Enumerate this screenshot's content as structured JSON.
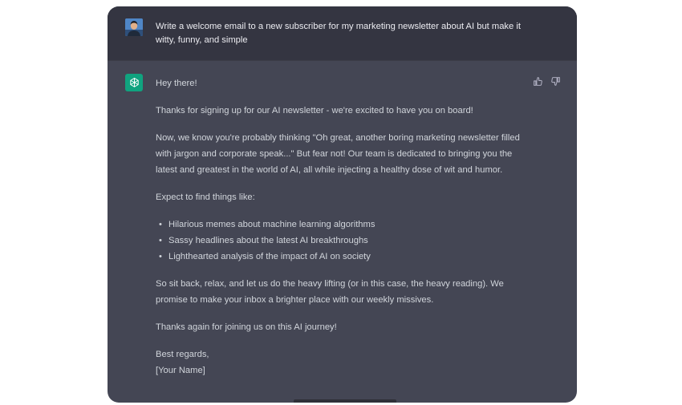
{
  "user_message": {
    "avatar_icon": "user-avatar-photo",
    "text": "Write a welcome email to a new subscriber for my marketing newsletter about AI but make it witty, funny, and simple"
  },
  "assistant_message": {
    "avatar_icon": "chatgpt-logo-icon",
    "avatar_color": "#10a37f",
    "greeting": "Hey there!",
    "p1": "Thanks for signing up for our AI newsletter - we're excited to have you on board!",
    "p2": "Now, we know you're probably thinking \"Oh great, another boring marketing newsletter filled with jargon and corporate speak...\" But fear not! Our team is dedicated to bringing you the latest and greatest in the world of AI, all while injecting a healthy dose of wit and humor.",
    "p3": "Expect to find things like:",
    "bullets": [
      "Hilarious memes about machine learning algorithms",
      "Sassy headlines about the latest AI breakthroughs",
      "Lighthearted analysis of the impact of AI on society"
    ],
    "p4": "So sit back, relax, and let us do the heavy lifting (or in this case, the heavy reading). We promise to make your inbox a brighter place with our weekly missives.",
    "p5": "Thanks again for joining us on this AI journey!",
    "signoff": "Best regards,",
    "signature": "[Your Name]"
  },
  "feedback": {
    "thumbs_up_icon": "thumbs-up-icon",
    "thumbs_down_icon": "thumbs-down-icon"
  },
  "colors": {
    "user_row_bg": "#343541",
    "assistant_row_bg": "#444654",
    "text": "#d1d5db"
  }
}
